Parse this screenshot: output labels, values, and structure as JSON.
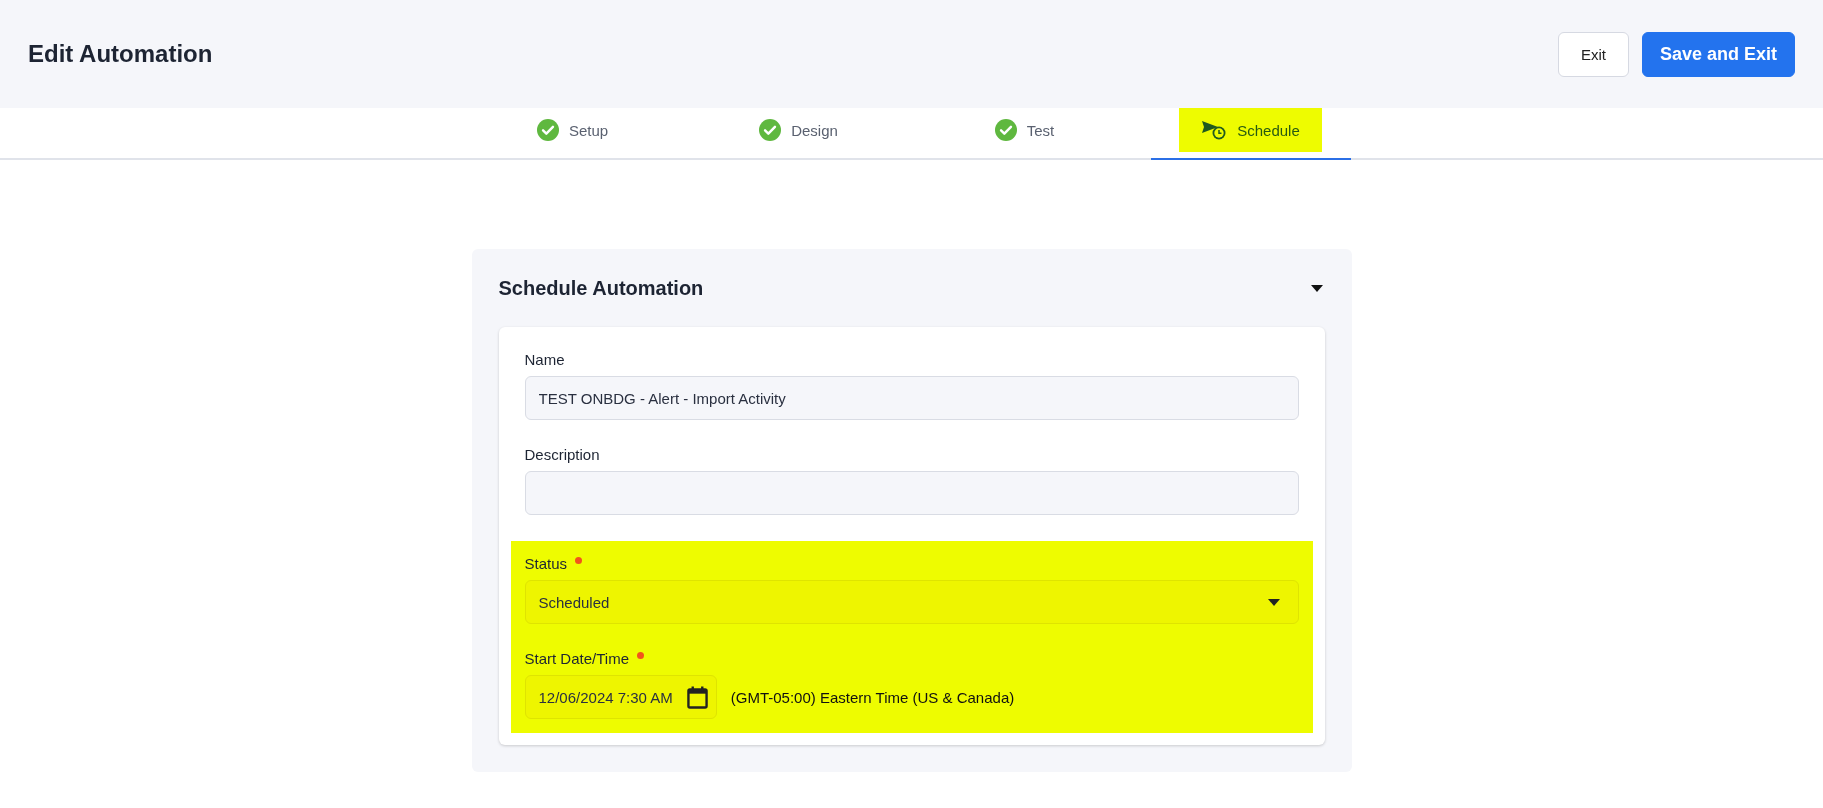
{
  "header": {
    "title": "Edit Automation",
    "buttons": [
      {
        "label": "Exit",
        "kind": "secondary"
      },
      {
        "label": "Save and Exit",
        "kind": "primary"
      }
    ]
  },
  "steps": [
    {
      "label": "Setup",
      "kind": "done",
      "selected": false,
      "highlighted": false
    },
    {
      "label": "Design",
      "kind": "done",
      "selected": false,
      "highlighted": false
    },
    {
      "label": "Test",
      "kind": "done",
      "selected": false,
      "highlighted": false
    },
    {
      "label": "Schedule",
      "kind": "schedule",
      "selected": true,
      "highlighted": true
    }
  ],
  "panel": {
    "title": "Schedule Automation",
    "expanded": true,
    "name": {
      "label": "Name",
      "value": "TEST ONBDG - Alert - Import Activity"
    },
    "description": {
      "label": "Description"
    },
    "highlighted_section": true,
    "status": {
      "label": "Status",
      "required": true,
      "value": "Scheduled"
    },
    "start": {
      "label": "Start Date/Time",
      "required": true,
      "value": "12/06/2024 7:30 AM",
      "timezone": "(GMT-05:00) Eastern Time (US & Canada)"
    }
  }
}
